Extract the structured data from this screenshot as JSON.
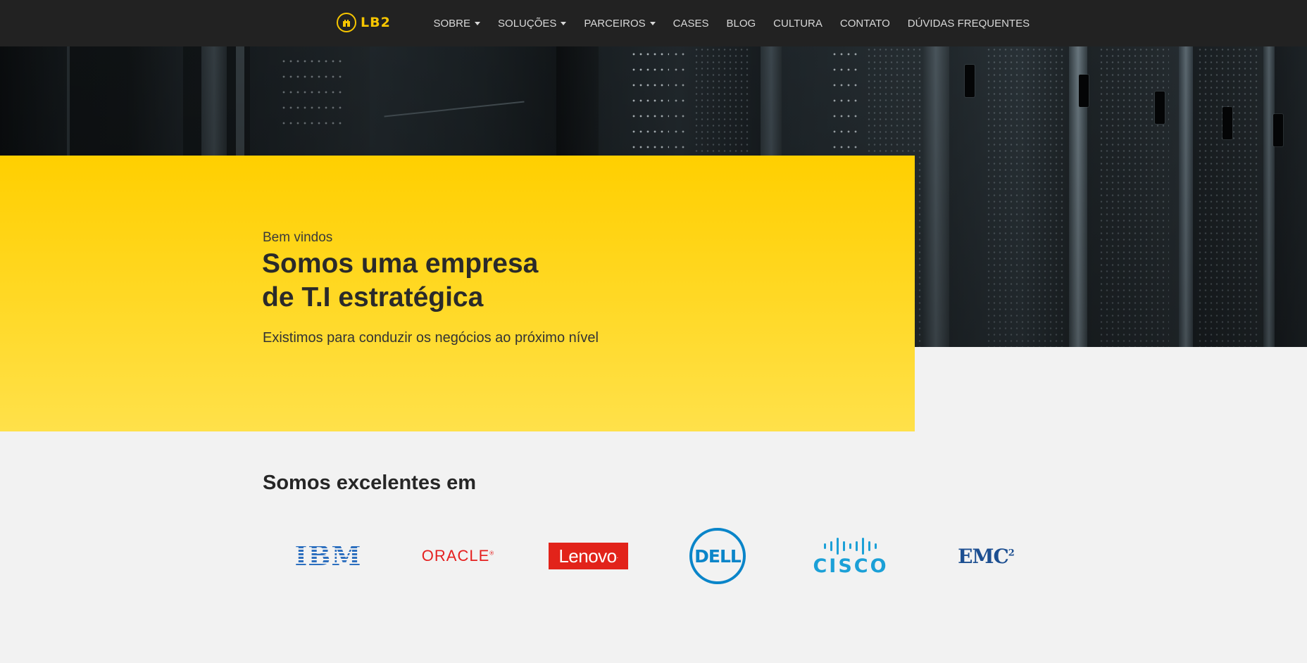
{
  "header": {
    "logo_text": "LB2",
    "logo_icon": "castle-icon",
    "nav_items": [
      {
        "label": "SOBRE",
        "dropdown": true
      },
      {
        "label": "SOLUÇÕES",
        "dropdown": true
      },
      {
        "label": "PARCEIROS",
        "dropdown": true
      },
      {
        "label": "CASES",
        "dropdown": false
      },
      {
        "label": "BLOG",
        "dropdown": false
      },
      {
        "label": "CULTURA",
        "dropdown": false
      },
      {
        "label": "CONTATO",
        "dropdown": false
      },
      {
        "label": "DÚVIDAS FREQUENTES",
        "dropdown": false
      }
    ]
  },
  "hero": {
    "eyebrow": "Bem vindos",
    "title_line1": "Somos uma empresa",
    "title_line2": "de T.I estratégica",
    "subtitle": "Existimos para conduzir os negócios ao próximo nível"
  },
  "expertise": {
    "title": "Somos excelentes em",
    "partners": [
      {
        "name": "IBM",
        "color": "#2c6fbf"
      },
      {
        "name": "ORACLE",
        "color": "#e5201f"
      },
      {
        "name": "Lenovo",
        "color": "#e2231a"
      },
      {
        "name": "DELL",
        "color": "#0a85c9"
      },
      {
        "name": "CISCO",
        "color": "#1ba0d7"
      },
      {
        "name": "EMC",
        "superscript": "2",
        "color": "#1d4f91"
      }
    ]
  },
  "colors": {
    "navbar": "#222222",
    "accent_yellow": "#ffcf00",
    "page_background": "#f2f2f2"
  }
}
